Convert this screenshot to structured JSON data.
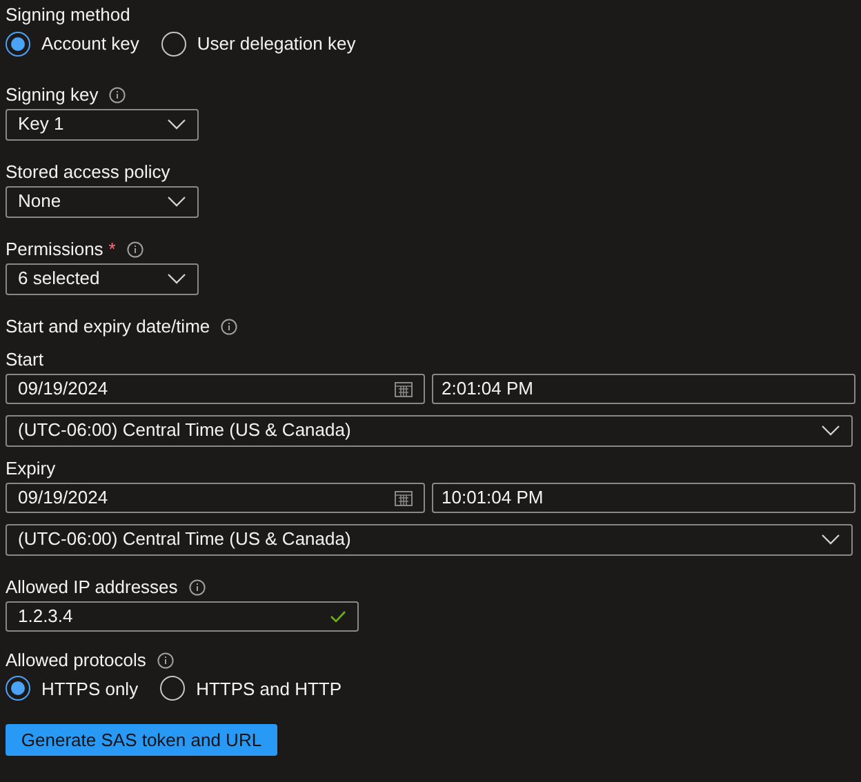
{
  "signing_method": {
    "label": "Signing method",
    "options": [
      {
        "label": "Account key",
        "selected": true
      },
      {
        "label": "User delegation key",
        "selected": false
      }
    ]
  },
  "signing_key": {
    "label": "Signing key",
    "info": true,
    "value": "Key 1"
  },
  "stored_access_policy": {
    "label": "Stored access policy",
    "info": false,
    "value": "None"
  },
  "permissions": {
    "label": "Permissions",
    "required_mark": "*",
    "info": true,
    "value": "6 selected"
  },
  "date_time": {
    "label": "Start and expiry date/time",
    "periods": [
      {
        "label": "Start",
        "date": "09/19/2024",
        "time": "2:01:04 PM",
        "timezone": "(UTC-06:00) Central Time (US & Canada)"
      },
      {
        "label": "Expiry",
        "date": "09/19/2024",
        "time": "10:01:04 PM",
        "timezone": "(UTC-06:00) Central Time (US & Canada)"
      }
    ]
  },
  "allowed_ip": {
    "label": "Allowed IP addresses",
    "value": "1.2.3.4",
    "valid": true
  },
  "allowed_protocols": {
    "label": "Allowed protocols",
    "options": [
      {
        "label": "HTTPS only",
        "selected": true
      },
      {
        "label": "HTTPS and HTTP",
        "selected": false
      }
    ]
  },
  "generate_button": "Generate SAS token and URL"
}
